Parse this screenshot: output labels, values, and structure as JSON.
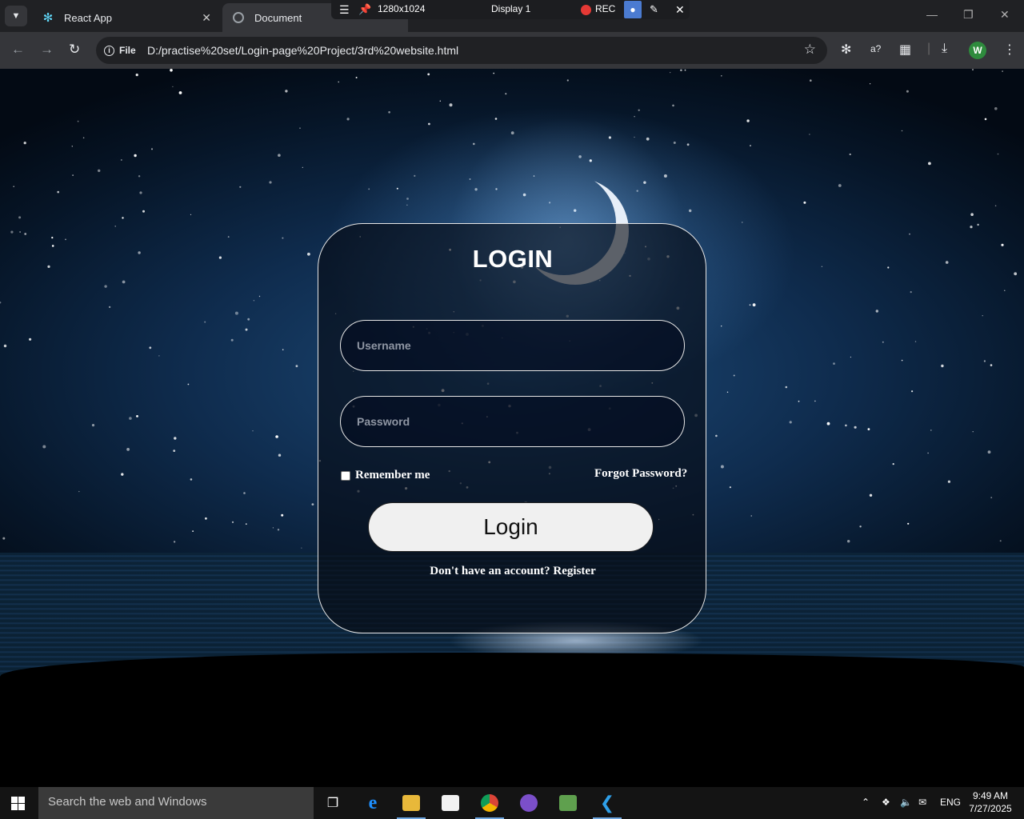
{
  "browser": {
    "tabs": [
      {
        "label": "React App",
        "icon": "react-icon"
      },
      {
        "label": "Document",
        "icon": "globe-icon"
      }
    ],
    "recorder": {
      "resolution": "1280x1024",
      "display": "Display 1",
      "rec_label": "REC"
    },
    "omnibox": {
      "chip": "File",
      "url": "D:/practise%20set/Login-page%20Project/3rd%20website.html"
    },
    "profile_initial": "W"
  },
  "login": {
    "title": "LOGIN",
    "username_placeholder": "Username",
    "password_placeholder": "Password",
    "remember_label": "Remember me",
    "remember_checked": false,
    "forgot_label": "Forgot Password?",
    "button_label": "Login",
    "register_text": "Don't have an account? Register"
  },
  "taskbar": {
    "search_placeholder": "Search the web and Windows",
    "apps": [
      "task-view",
      "edge",
      "file-explorer",
      "store",
      "chrome",
      "github-desktop",
      "node",
      "vscode"
    ],
    "language": "ENG",
    "time": "9:49 AM",
    "date": "7/27/2025"
  },
  "colors": {
    "card_border": "#e5e5e5",
    "sky_mid": "#1d4a78",
    "sky_dark": "#061527",
    "button_bg": "#f0f0f0"
  }
}
